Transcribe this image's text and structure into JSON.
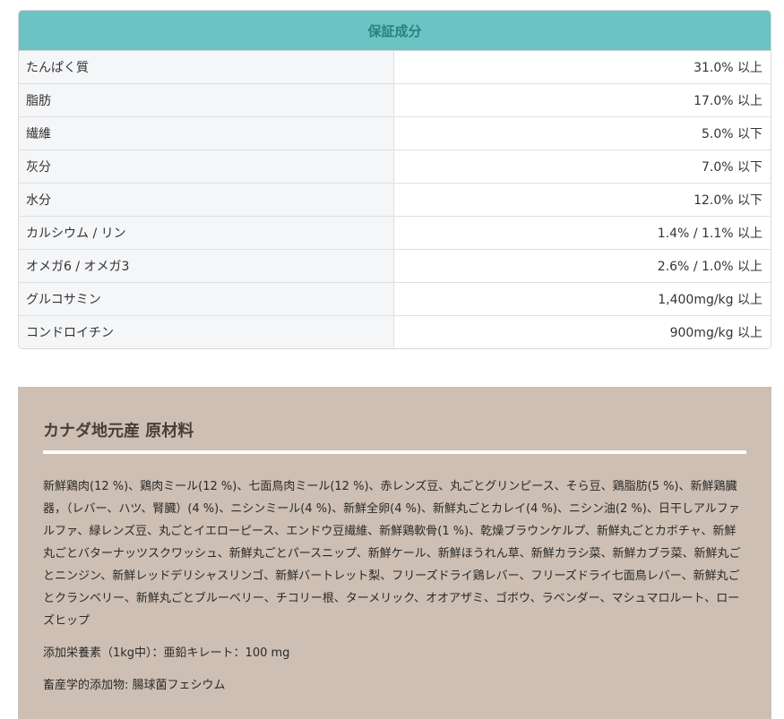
{
  "analysis": {
    "title": "保証成分",
    "rows": [
      {
        "name": "たんぱく質",
        "value": "31.0% 以上"
      },
      {
        "name": "脂肪",
        "value": "17.0% 以上"
      },
      {
        "name": "繊維",
        "value": "5.0% 以下"
      },
      {
        "name": "灰分",
        "value": "7.0% 以下"
      },
      {
        "name": "水分",
        "value": "12.0% 以下"
      },
      {
        "name": "カルシウム / リン",
        "value": "1.4% / 1.1% 以上"
      },
      {
        "name": "オメガ6 / オメガ3",
        "value": "2.6% / 1.0% 以上"
      },
      {
        "name": "グルコサミン",
        "value": "1,400mg/kg 以上"
      },
      {
        "name": "コンドロイチン",
        "value": "900mg/kg 以上"
      }
    ]
  },
  "ingredients": {
    "title": "カナダ地元産 原材料",
    "text": "新鮮鶏肉(12 %)、鶏肉ミール(12 %)、七面鳥肉ミール(12 %)、赤レンズ豆、丸ごとグリンピース、そら豆、鶏脂肪(5 %)、新鮮鶏臓器，（レバー、ハツ、腎臓）(4 %)、ニシンミール(4 %)、新鮮全卵(4 %)、新鮮丸ごとカレイ(4 %)、ニシン油(2 %)、日干しアルファルファ、緑レンズ豆、丸ごとイエローピース、エンドウ豆繊維、新鮮鶏軟骨(1 %)、乾燥ブラウンケルプ、新鮮丸ごとカボチャ、新鮮丸ごとバターナッツスクワッシュ、新鮮丸ごとパースニップ、新鮮ケール、新鮮ほうれん草、新鮮カラシ菜、新鮮カブラ菜、新鮮丸ごとニンジン、新鮮レッドデリシャスリンゴ、新鮮バートレット梨、フリーズドライ鶏レバー、フリーズドライ七面鳥レバー、新鮮丸ごとクランベリー、新鮮丸ごとブルーベリー、チコリー根、ターメリック、オオアザミ、ゴボウ、ラベンダー、マシュマロルート、ローズヒップ",
    "additive_note": "添加栄養素（1kg中）：亜鉛キレート：100 mg",
    "zootechnical_note": "畜産学的添加物: 腸球菌フェシウム"
  }
}
